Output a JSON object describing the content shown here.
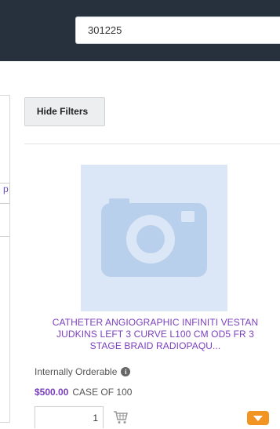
{
  "search": {
    "value": "301225"
  },
  "filters": {
    "hide_label": "Hide Filters"
  },
  "left_panel": {
    "fragment_text": "p"
  },
  "product": {
    "title": "CATHETER ANGIOGRAPHIC INFINITI VESTAN JUDKINS LEFT 3 CURVE L100 CM OD5 FR 3 STAGE BRAID RADIOPAQU...",
    "orderable_label": "Internally Orderable",
    "info_icon_glyph": "i",
    "price": "$500.00",
    "unit": "CASE OF 100",
    "quantity": "1"
  },
  "icons": {
    "image_placeholder": "camera-icon",
    "cart": "cart-icon",
    "more": "chevron-down-icon"
  },
  "colors": {
    "topbar": "#26313d",
    "link_purple": "#7b3fbf",
    "accent_orange": "#f29422",
    "image_bg": "#dbe7f6"
  }
}
